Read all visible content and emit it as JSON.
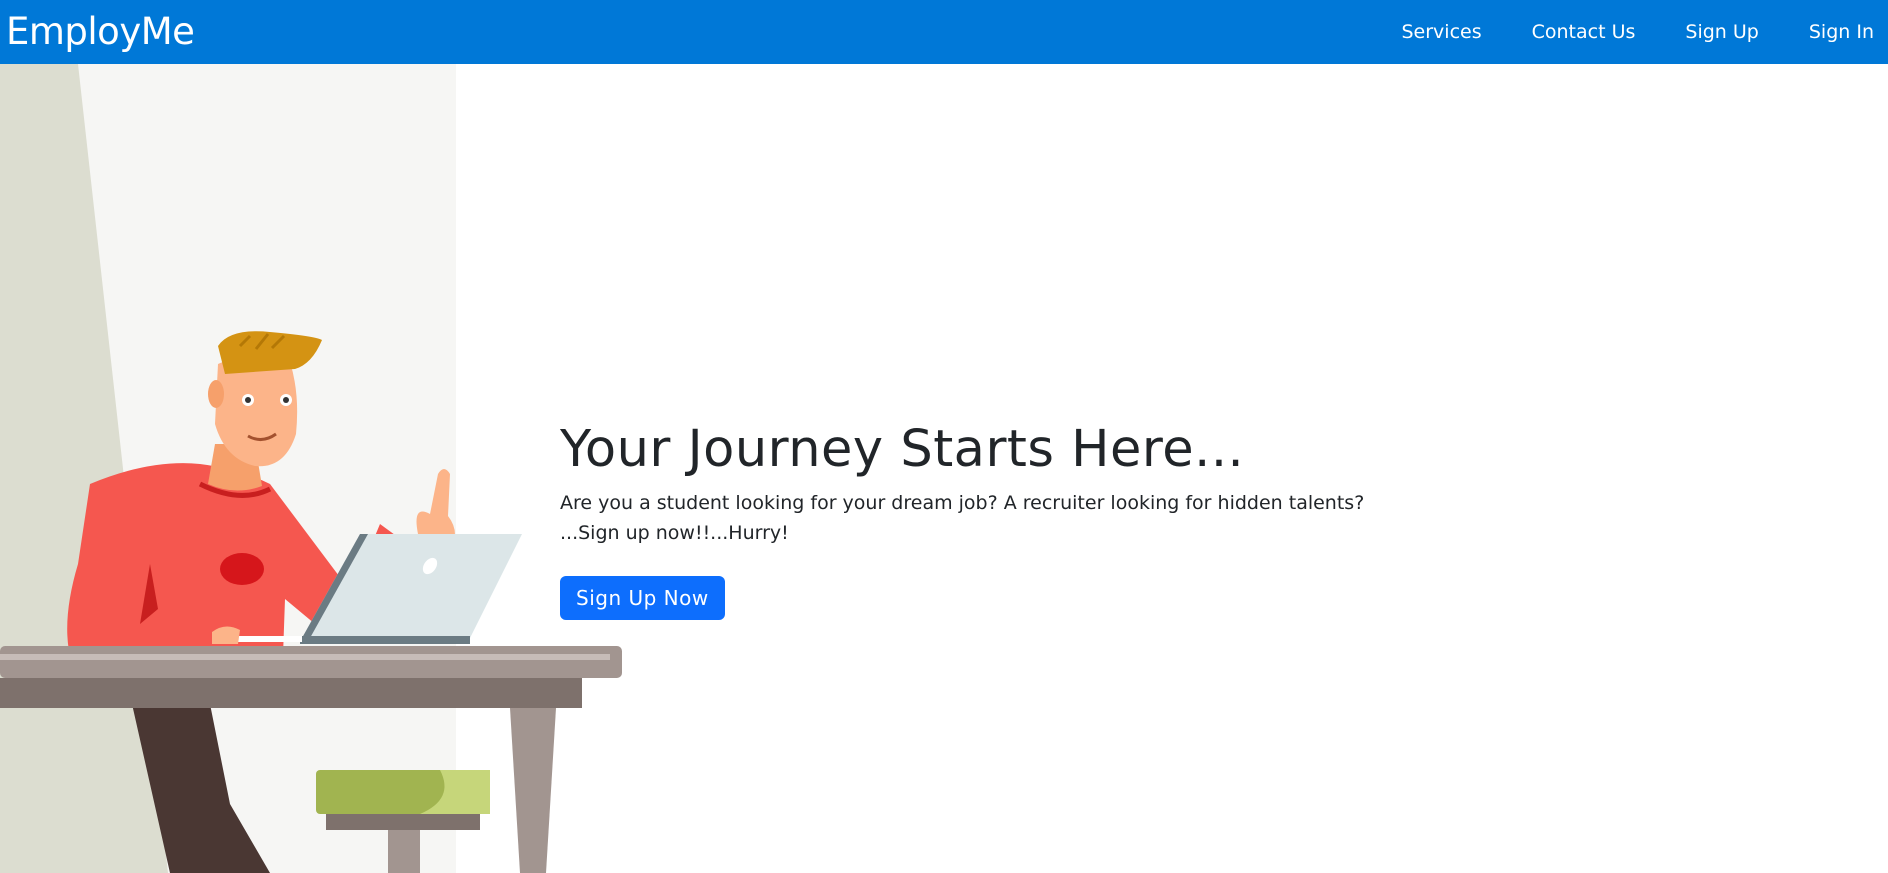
{
  "navbar": {
    "brand": "EmployMe",
    "links": [
      "Services",
      "Contact Us",
      "Sign Up",
      "Sign In"
    ],
    "background": "#0078d7"
  },
  "hero": {
    "title": "Your Journey Starts Here...",
    "description_line1": "Are you a student looking for your dream job? A recruiter looking for hidden talents?",
    "description_line2": "...Sign up now!!...Hurry!",
    "cta_label": "Sign Up Now",
    "cta_color": "#0d6efd",
    "illustration": "man-at-laptop-pointing-up"
  }
}
